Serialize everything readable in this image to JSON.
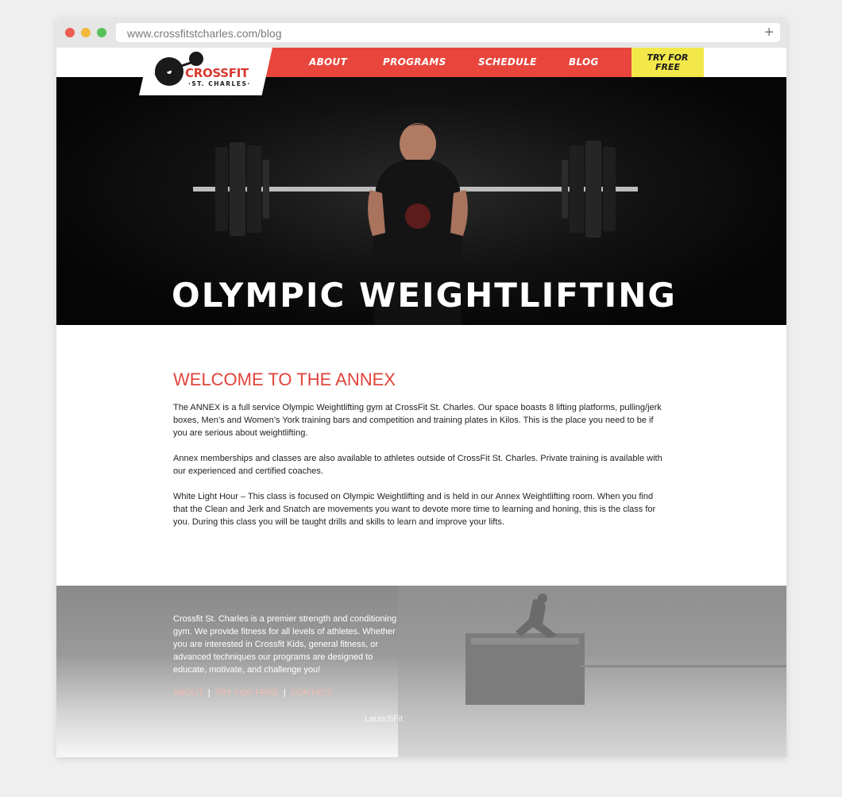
{
  "browser": {
    "url": "www.crossfitstcharles.com/blog"
  },
  "logo": {
    "name": "CROSSFIT",
    "subtitle": "·ST. CHARLES·"
  },
  "nav": {
    "items": [
      "ABOUT",
      "PROGRAMS",
      "SCHEDULE",
      "BLOG"
    ],
    "try_line1": "TRY FOR",
    "try_line2": "FREE"
  },
  "hero": {
    "title": "OLYMPIC WEIGHTLIFTING"
  },
  "main": {
    "heading": "WELCOME TO THE ANNEX",
    "paragraphs": [
      "The ANNEX is a full service Olympic Weightlifting gym at CrossFit St. Charles. Our space boasts 8 lifting platforms, pulling/jerk boxes, Men’s and Women’s York training bars and competition and training plates in Kilos. This is the place you need to be if you are serious about weightlifting.",
      "Annex memberships and classes are also available to athletes outside of CrossFit St. Charles. Private training is available with our experienced and certified coaches.",
      "White Light Hour – This class is focused on Olympic Weightlifting and is held in our Annex Weightlifting room. When you find that the Clean and Jerk and Snatch are movements  you want to devote more time to learning and honing, this is the class for you. During this class you will be taught drills and skills to learn and improve your lifts."
    ]
  },
  "footer": {
    "text": "Crossfit St. Charles is a premier strength and conditioning gym. We provide fitness for all levels of athletes. Whether you are interested in Crossfit Kids, general fitness, or advanced techniques our programs are designed to educate, motivate, and challenge you!",
    "links": [
      "ABOUT",
      "TRY FOR FREE",
      "CONTACT"
    ],
    "separator": "|",
    "credit": "LaunchFit"
  },
  "colors": {
    "brand_red": "#e8463d",
    "try_yellow": "#f3e84a",
    "heading_red": "#e0443a"
  }
}
